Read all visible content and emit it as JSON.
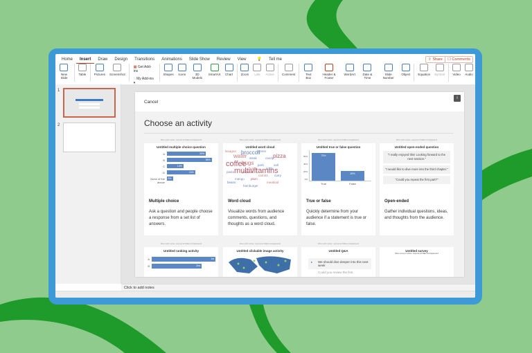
{
  "ribbon": {
    "tabs": [
      "Home",
      "Insert",
      "Draw",
      "Design",
      "Transitions",
      "Animations",
      "Slide Show",
      "Review",
      "View",
      "Tell me"
    ],
    "active_tab": "Insert",
    "share": "Share",
    "comments": "Comments",
    "buttons": {
      "new_slide": "New Slide",
      "table": "Table",
      "pictures": "Pictures",
      "screenshot": "Screenshot",
      "get_addins": "Get Add-ins",
      "my_addins": "My Add-ins",
      "shapes": "Shapes",
      "icons": "Icons",
      "models": "3D Models",
      "smartart": "SmartArt",
      "chart": "Chart",
      "zoom": "Zoom",
      "link": "Link",
      "action": "Action",
      "comment": "Comment",
      "textbox": "Text Box",
      "header": "Header & Footer",
      "wordart": "WordArt",
      "datetime": "Date & Time",
      "slidenum": "Slide Number",
      "object": "Object",
      "equation": "Equation",
      "symbol": "Symbol",
      "video": "Video",
      "audio": "Audio"
    }
  },
  "slides": {
    "numbers": [
      "1",
      "2"
    ]
  },
  "panel": {
    "cancel": "Cancel",
    "info": "i",
    "title": "Choose an activity",
    "hint": "When poll is active, respond at PollEv.com/appleword",
    "cards": [
      {
        "title": "Multiple choice",
        "desc": "Ask a question and people choose a response from a set list of answers.",
        "preview_title": "Untitled multiple choice question"
      },
      {
        "title": "Word cloud",
        "desc": "Visualize words from audience comments, questions, and thoughts as a word cloud.",
        "preview_title": "Untitled word cloud"
      },
      {
        "title": "True or false",
        "desc": "Quickly determine from your audience if a statement is true or false.",
        "preview_title": "Untitled true or false question"
      },
      {
        "title": "Open-ended",
        "desc": "Gather individual questions, ideas, and thoughts from the audience.",
        "preview_title": "Untitled open-ended question"
      },
      {
        "preview_title": "Untitled ranking activity"
      },
      {
        "preview_title": "Untitled clickable image activity"
      },
      {
        "preview_title": "Untitled Q&A"
      },
      {
        "preview_title": "Untitled survey",
        "preview_sub": "When survey is active, respond at PollEv.com/appleword"
      }
    ]
  },
  "chart_data": [
    {
      "type": "bar",
      "title": "Untitled multiple choice question",
      "categories": [
        "A",
        "B",
        "C",
        "D",
        "None of the above"
      ],
      "values": [
        33,
        38,
        14,
        24,
        5
      ],
      "unit": "%"
    },
    {
      "type": "bar",
      "title": "Untitled true or false question",
      "categories": [
        "True",
        "False"
      ],
      "values": [
        73,
        25
      ],
      "yticks": [
        "0%",
        "20%",
        "40%",
        "60%"
      ],
      "unit": "%"
    },
    {
      "type": "bar",
      "title": "Untitled ranking activity",
      "categories": [
        "A",
        "B"
      ],
      "labels": [
        "1st",
        "2nd"
      ]
    }
  ],
  "wordcloud": [
    "lasagna",
    "broccoli",
    "lobster",
    "pizza",
    "water",
    "steak",
    "candy",
    "coffee",
    "bugs",
    "pork",
    "salt",
    "multivitamins",
    "cake",
    "sushi",
    "pasta",
    "popcorn",
    "carrots",
    "curry",
    "mango",
    "plum",
    "meatloaf",
    "beans",
    "hamburger"
  ],
  "open_ended": [
    "\"I really enjoyed this! Looking forward to the next session.\"",
    "\"I would like to dive more into the third chapter.\"",
    "\"Could you repeat the first part?\""
  ],
  "qa": [
    "We should dive deeper into this next week",
    "Could you review the first"
  ],
  "notes": "Click to add notes"
}
